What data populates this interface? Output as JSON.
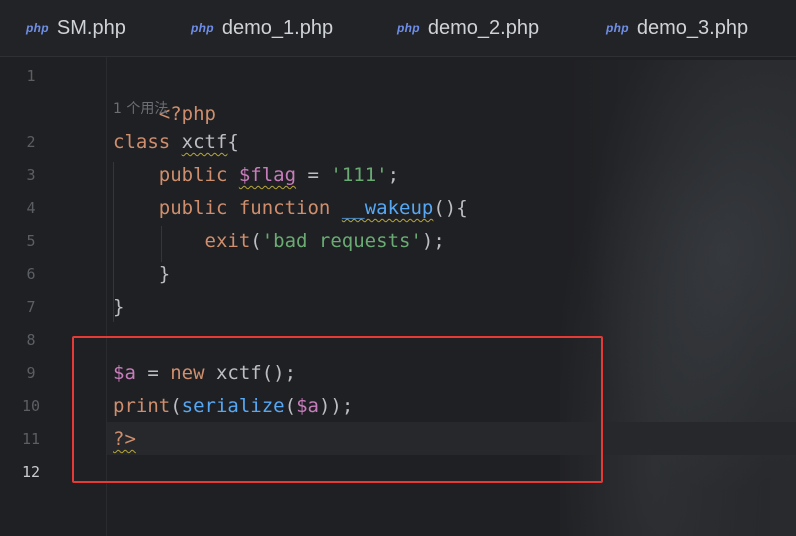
{
  "tabs": [
    {
      "icon": "php",
      "label": "SM.php"
    },
    {
      "icon": "php",
      "label": "demo_1.php"
    },
    {
      "icon": "php",
      "label": "demo_2.php"
    },
    {
      "icon": "php",
      "label": "demo_3.php"
    }
  ],
  "usage_hint": "1 个用法",
  "line_numbers": [
    "1",
    "2",
    "3",
    "4",
    "5",
    "6",
    "7",
    "8",
    "9",
    "10",
    "11",
    "12"
  ],
  "code": {
    "l1": "<?php",
    "l2_kw": "class",
    "l2_name": "xctf",
    "l2_brace": "{",
    "l3_kw": "public",
    "l3_var": "$flag",
    "l3_eq": " = ",
    "l3_str": "'111'",
    "l3_end": ";",
    "l4_kw1": "public",
    "l4_kw2": "function",
    "l4_fn": "__wakeup",
    "l4_end": "(){",
    "l5_kw": "exit",
    "l5_open": "(",
    "l5_str": "'bad requests'",
    "l5_end": ");",
    "l6": "}",
    "l7": "}",
    "l9_var": "$a",
    "l9_eq": " = ",
    "l9_kw": "new",
    "l9_rest": " xctf();",
    "l10_fn1": "print",
    "l10_p1": "(",
    "l10_fn2": "serialize",
    "l10_p2": "(",
    "l10_var": "$a",
    "l10_end": "));",
    "l11": "?>"
  },
  "colors": {
    "keyword": "#cf8e6d",
    "variable": "#c77dbb",
    "string": "#6aab73",
    "function": "#56a8f5",
    "annotation_box": "#e53a35"
  }
}
